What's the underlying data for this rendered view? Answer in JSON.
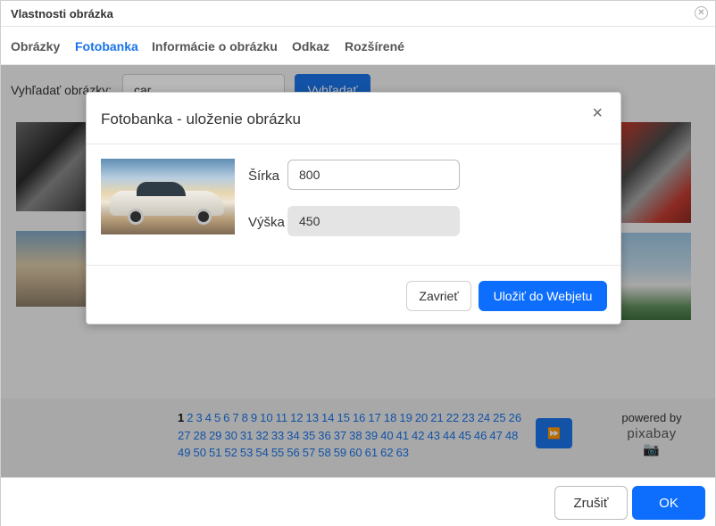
{
  "window": {
    "title": "Vlastnosti obrázka",
    "close_icon": "close-circle-icon"
  },
  "tabs": [
    {
      "label": "Obrázky",
      "active": false
    },
    {
      "label": "Fotobanka",
      "active": true
    },
    {
      "label": "Informácie o obrázku",
      "active": false
    },
    {
      "label": "Odkaz",
      "active": false
    },
    {
      "label": "Rozšírené",
      "active": false
    }
  ],
  "search": {
    "label": "Vyhľadať obrázky:",
    "value": "car",
    "button_label": "Vyhľadať"
  },
  "pagination": {
    "current": "1",
    "pages": [
      "1",
      "2",
      "3",
      "4",
      "5",
      "6",
      "7",
      "8",
      "9",
      "10",
      "11",
      "12",
      "13",
      "14",
      "15",
      "16",
      "17",
      "18",
      "19",
      "20",
      "21",
      "22",
      "23",
      "24",
      "25",
      "26",
      "27",
      "28",
      "29",
      "30",
      "31",
      "32",
      "33",
      "34",
      "35",
      "36",
      "37",
      "38",
      "39",
      "40",
      "41",
      "42",
      "43",
      "44",
      "45",
      "46",
      "47",
      "48",
      "49",
      "50",
      "51",
      "52",
      "53",
      "54",
      "55",
      "56",
      "57",
      "58",
      "59",
      "60",
      "61",
      "62",
      "63"
    ],
    "next_icon": "fast-forward-icon"
  },
  "powered_by": {
    "label": "powered by",
    "logo_text": "pixabay"
  },
  "modal": {
    "title": "Fotobanka - uloženie obrázku",
    "close_glyph": "×",
    "width_label": "Šírka",
    "width_value": "800",
    "height_label": "Výška",
    "height_value": "450",
    "close_button_label": "Zavrieť",
    "save_button_label": "Uložiť do Webjetu"
  },
  "footer": {
    "cancel_label": "Zrušiť",
    "ok_label": "OK"
  },
  "colors": {
    "accent": "#1a73e8",
    "primary_button": "#0d6efd",
    "overlay": "rgba(0,0,0,0.28)"
  }
}
